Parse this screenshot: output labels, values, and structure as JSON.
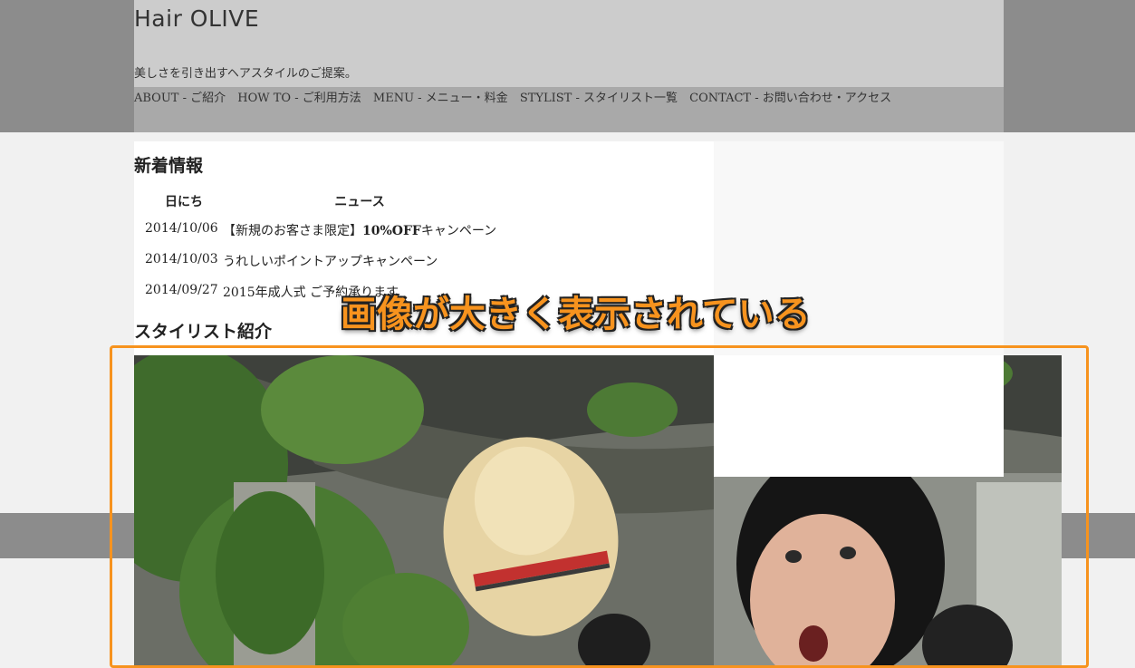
{
  "site": {
    "logo": "Hair OLIVE",
    "tagline": "美しさを引き出すヘアスタイルのご提案。"
  },
  "nav": {
    "items": [
      {
        "label": "ABOUT - ご紹介"
      },
      {
        "label": "HOW TO - ご利用方法"
      },
      {
        "label": "MENU - メニュー・料金"
      },
      {
        "label": "STYLIST - スタイリスト一覧"
      },
      {
        "label": "CONTACT - お問い合わせ・アクセス"
      }
    ]
  },
  "news": {
    "heading": "新着情報",
    "col_date": "日にち",
    "col_news": "ニュース",
    "rows": [
      {
        "date": "2014/10/06",
        "text_pre": "【新規のお客さま限定】",
        "text_bold": "10%OFF",
        "text_post": "キャンペーン"
      },
      {
        "date": "2014/10/03",
        "text_pre": "うれしい",
        "text_bold": "",
        "text_post": "ポイントアップキャンペーン"
      },
      {
        "date": "2014/09/27",
        "text_pre": "2015年成人式 ご予約承ります",
        "text_bold": "",
        "text_post": ""
      }
    ]
  },
  "stylist": {
    "heading": "スタイリスト紹介"
  },
  "annotation": {
    "text": "画像が大きく表示されている",
    "color": "#f7931e"
  }
}
